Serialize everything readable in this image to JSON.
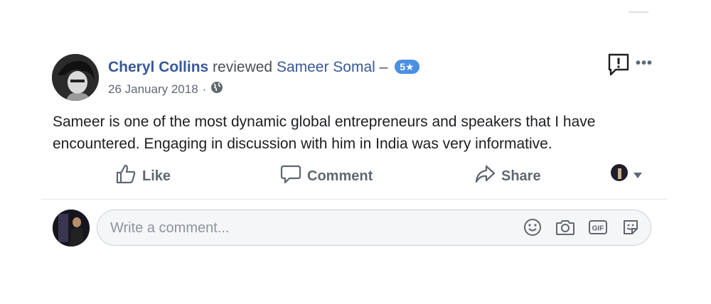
{
  "post": {
    "author": "Cheryl Collins",
    "action": "reviewed",
    "subject": "Sameer Somal",
    "separator": "–",
    "rating_badge": "5★",
    "date": "26 January 2018",
    "meta_dot": "·",
    "privacy_icon": "globe-icon",
    "text": "Sameer is one of the most dynamic global entrepreneurs and speakers that I have encountered. Engaging in discussion with him in India was very informative."
  },
  "actions": {
    "like": "Like",
    "comment": "Comment",
    "share": "Share"
  },
  "comment_box": {
    "placeholder": "Write a comment...",
    "icons": [
      "emoji-icon",
      "camera-icon",
      "gif-icon",
      "sticker-icon"
    ],
    "gif_label": "GIF"
  },
  "colors": {
    "link": "#385898",
    "badge": "#4a90e2",
    "action_text": "#606770"
  }
}
